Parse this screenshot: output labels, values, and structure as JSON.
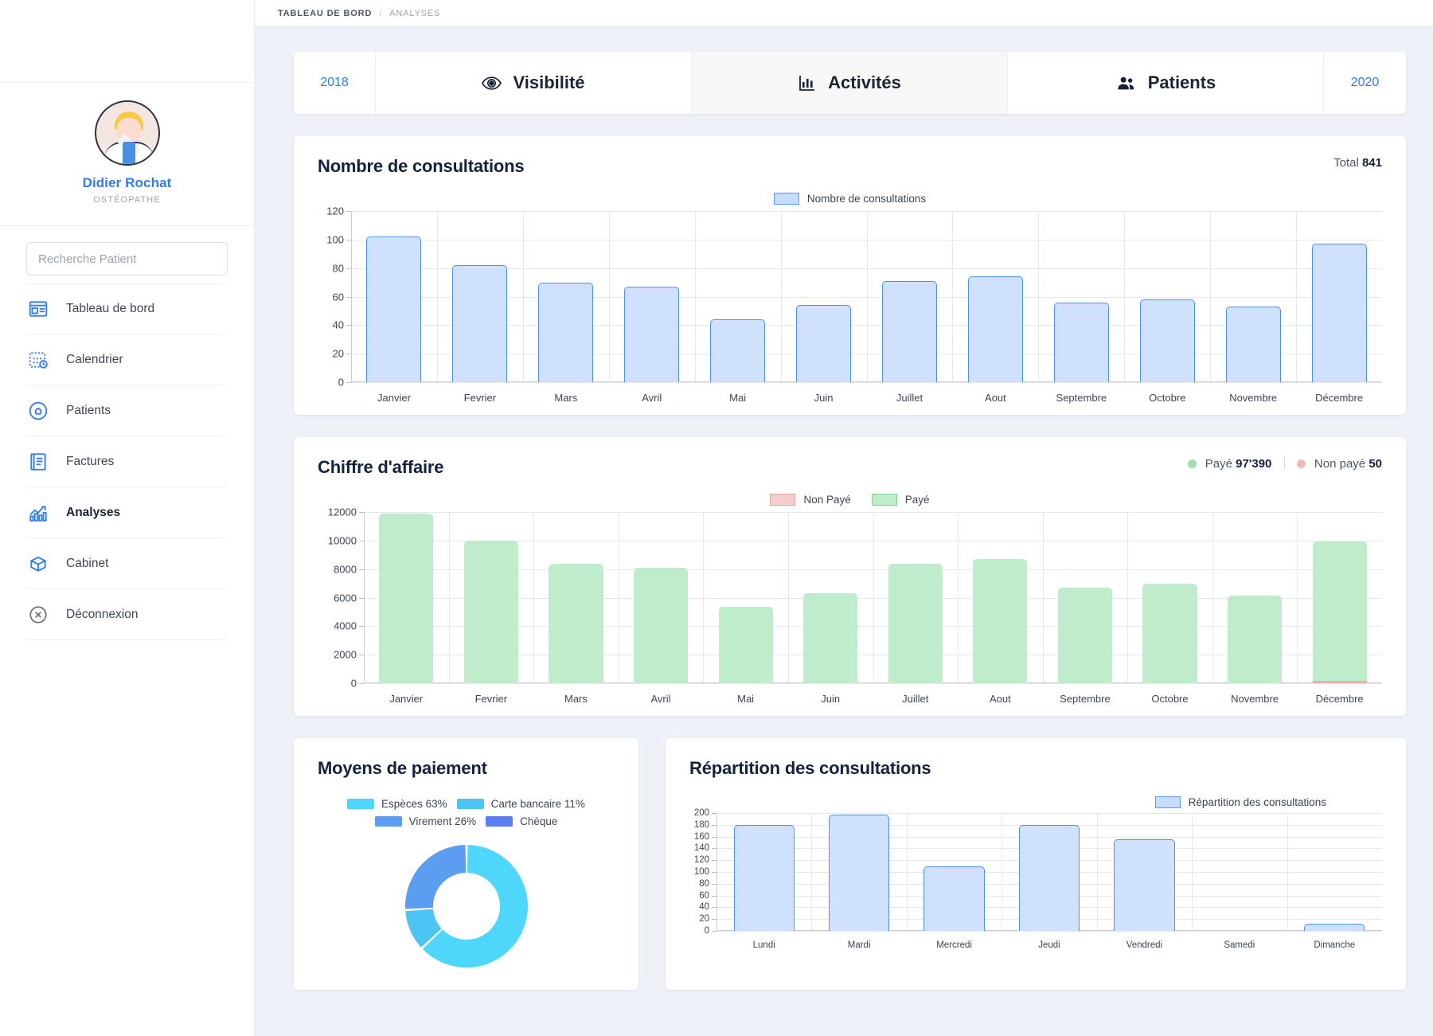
{
  "breadcrumb": {
    "root": "TABLEAU DE BORD",
    "sep": "/",
    "current": "ANALYSES"
  },
  "sidebar": {
    "profile": {
      "name": "Didier Rochat",
      "role": "OSTÉOPATHE",
      "avatar_icon": "doctor-avatar"
    },
    "search": {
      "placeholder": "Recherche Patient",
      "value": ""
    },
    "items": [
      {
        "label": "Tableau de bord",
        "icon": "dashboard-icon",
        "active": false
      },
      {
        "label": "Calendrier",
        "icon": "calendar-clock-icon",
        "active": false
      },
      {
        "label": "Patients",
        "icon": "patient-icon",
        "active": false
      },
      {
        "label": "Factures",
        "icon": "invoice-icon",
        "active": false
      },
      {
        "label": "Analyses",
        "icon": "analytics-icon",
        "active": true
      },
      {
        "label": "Cabinet",
        "icon": "box-icon",
        "active": false
      },
      {
        "label": "Déconnexion",
        "icon": "logout-icon",
        "active": false
      }
    ]
  },
  "tabs": {
    "year_prev": "2018",
    "year_next": "2020",
    "items": [
      {
        "label": "Visibilité",
        "icon": "eye-icon",
        "active": false
      },
      {
        "label": "Activités",
        "icon": "bar-chart-icon",
        "active": true
      },
      {
        "label": "Patients",
        "icon": "people-icon",
        "active": false
      }
    ]
  },
  "cards": {
    "consultations": {
      "title": "Nombre de consultations",
      "total_label": "Total",
      "total_value": "841"
    },
    "revenue": {
      "title": "Chiffre d'affaire",
      "paid_label": "Payé",
      "paid_value": "97'390",
      "unpaid_label": "Non payé",
      "unpaid_value": "50",
      "paid_color": "#9fe0ae",
      "unpaid_color": "#f3b8b8"
    },
    "payments": {
      "title": "Moyens de paiement"
    },
    "distribution": {
      "title": "Répartition des consultations"
    }
  },
  "chart_data": [
    {
      "type": "bar",
      "title": "Nombre de consultations",
      "legend": [
        "Nombre de consultations"
      ],
      "legend_position": "top-center",
      "categories": [
        "Janvier",
        "Fevrier",
        "Mars",
        "Avril",
        "Mai",
        "Juin",
        "Juillet",
        "Aout",
        "Septembre",
        "Octobre",
        "Novembre",
        "Décembre"
      ],
      "values": [
        102,
        82,
        70,
        67,
        44,
        54,
        71,
        74,
        56,
        58,
        53,
        97
      ],
      "yticks": [
        0,
        20,
        40,
        60,
        80,
        100,
        120
      ],
      "ylim": [
        0,
        120
      ],
      "xlabel": "",
      "ylabel": "",
      "grid": true,
      "bar_color": "#cfe1fd",
      "bar_border": "#4a90f5"
    },
    {
      "type": "bar",
      "title": "Chiffre d'affaire",
      "legend": [
        "Non Payé",
        "Payé"
      ],
      "legend_position": "top-center",
      "categories": [
        "Janvier",
        "Fevrier",
        "Mars",
        "Avril",
        "Mai",
        "Juin",
        "Juillet",
        "Aout",
        "Septembre",
        "Octobre",
        "Novembre",
        "Décembre"
      ],
      "series": [
        {
          "name": "Payé",
          "values": [
            11900,
            10000,
            8350,
            8100,
            5350,
            6300,
            8400,
            8700,
            6700,
            7000,
            6150,
            9950
          ],
          "color": "#bfeccb"
        },
        {
          "name": "Non Payé",
          "values": [
            0,
            0,
            0,
            0,
            0,
            0,
            0,
            0,
            0,
            0,
            0,
            50
          ],
          "color": "#f3aaaa"
        }
      ],
      "yticks": [
        0,
        2000,
        4000,
        6000,
        8000,
        10000,
        12000
      ],
      "ylim": [
        0,
        12000
      ],
      "xlabel": "",
      "ylabel": "",
      "grid": true
    },
    {
      "type": "pie",
      "title": "Moyens de paiement",
      "labels": [
        "Espèces 63%",
        "Carte bancaire 11%",
        "Virement 26%",
        "Chèque"
      ],
      "slice_names": [
        "Espèces",
        "Carte bancaire",
        "Virement",
        "Chèque"
      ],
      "values": [
        63,
        11,
        26,
        0
      ],
      "colors": [
        "#4fd7fb",
        "#4cc5f5",
        "#5b9df0",
        "#5b7ff0"
      ],
      "donut": true,
      "legend_position": "top"
    },
    {
      "type": "bar",
      "title": "Répartition des consultations",
      "legend": [
        "Répartition des consultations"
      ],
      "legend_position": "top-right",
      "categories": [
        "Lundi",
        "Mardi",
        "Mercredi",
        "Jeudi",
        "Vendredi",
        "Samedi",
        "Dimanche"
      ],
      "values": [
        180,
        197,
        110,
        180,
        155,
        0,
        12
      ],
      "yticks": [
        0,
        20,
        40,
        60,
        80,
        100,
        120,
        140,
        160,
        180,
        200
      ],
      "ylim": [
        0,
        200
      ],
      "xlabel": "",
      "ylabel": "",
      "grid": true,
      "bar_color": "#cfe1fd",
      "bar_border": "#4a90f5"
    }
  ]
}
